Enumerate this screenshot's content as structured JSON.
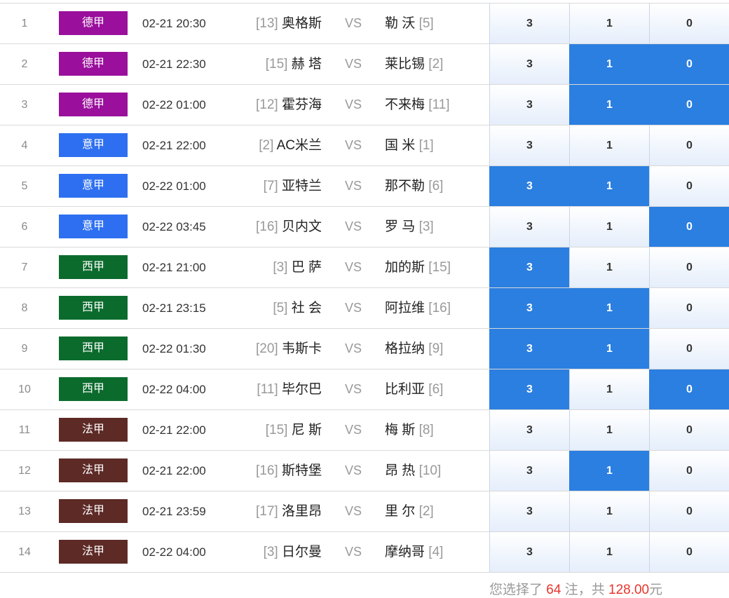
{
  "colors": {
    "bundesliga": "#9a0f9c",
    "serie_a": "#2d6ff0",
    "la_liga": "#0b6b2d",
    "ligue_1": "#5d2a26",
    "selected": "#2b7fe0",
    "highlight": "#e8342b"
  },
  "vs_label": "VS",
  "options": [
    "3",
    "1",
    "0"
  ],
  "matches": [
    {
      "no": "1",
      "league": "德甲",
      "league_color": "#9a0f9c",
      "time": "02-21 20:30",
      "home_rank": "[13]",
      "home": "奥格斯",
      "away": "勒 沃",
      "away_rank": "[5]",
      "selected": [
        false,
        false,
        false
      ]
    },
    {
      "no": "2",
      "league": "德甲",
      "league_color": "#9a0f9c",
      "time": "02-21 22:30",
      "home_rank": "[15]",
      "home": "赫 塔",
      "away": "莱比锡",
      "away_rank": "[2]",
      "selected": [
        false,
        true,
        true
      ]
    },
    {
      "no": "3",
      "league": "德甲",
      "league_color": "#9a0f9c",
      "time": "02-22 01:00",
      "home_rank": "[12]",
      "home": "霍芬海",
      "away": "不来梅",
      "away_rank": "[11]",
      "selected": [
        false,
        true,
        true
      ]
    },
    {
      "no": "4",
      "league": "意甲",
      "league_color": "#2d6ff0",
      "time": "02-21 22:00",
      "home_rank": "[2]",
      "home": "AC米兰",
      "away": "国 米",
      "away_rank": "[1]",
      "selected": [
        false,
        false,
        false
      ]
    },
    {
      "no": "5",
      "league": "意甲",
      "league_color": "#2d6ff0",
      "time": "02-22 01:00",
      "home_rank": "[7]",
      "home": "亚特兰",
      "away": "那不勒",
      "away_rank": "[6]",
      "selected": [
        true,
        true,
        false
      ]
    },
    {
      "no": "6",
      "league": "意甲",
      "league_color": "#2d6ff0",
      "time": "02-22 03:45",
      "home_rank": "[16]",
      "home": "贝内文",
      "away": "罗 马",
      "away_rank": "[3]",
      "selected": [
        false,
        false,
        true
      ]
    },
    {
      "no": "7",
      "league": "西甲",
      "league_color": "#0b6b2d",
      "time": "02-21 21:00",
      "home_rank": "[3]",
      "home": "巴 萨",
      "away": "加的斯",
      "away_rank": "[15]",
      "selected": [
        true,
        false,
        false
      ]
    },
    {
      "no": "8",
      "league": "西甲",
      "league_color": "#0b6b2d",
      "time": "02-21 23:15",
      "home_rank": "[5]",
      "home": "社 会",
      "away": "阿拉维",
      "away_rank": "[16]",
      "selected": [
        true,
        true,
        false
      ]
    },
    {
      "no": "9",
      "league": "西甲",
      "league_color": "#0b6b2d",
      "time": "02-22 01:30",
      "home_rank": "[20]",
      "home": "韦斯卡",
      "away": "格拉纳",
      "away_rank": "[9]",
      "selected": [
        true,
        true,
        false
      ]
    },
    {
      "no": "10",
      "league": "西甲",
      "league_color": "#0b6b2d",
      "time": "02-22 04:00",
      "home_rank": "[11]",
      "home": "毕尔巴",
      "away": "比利亚",
      "away_rank": "[6]",
      "selected": [
        true,
        false,
        true
      ]
    },
    {
      "no": "11",
      "league": "法甲",
      "league_color": "#5d2a26",
      "time": "02-21 22:00",
      "home_rank": "[15]",
      "home": "尼 斯",
      "away": "梅 斯",
      "away_rank": "[8]",
      "selected": [
        false,
        false,
        false
      ]
    },
    {
      "no": "12",
      "league": "法甲",
      "league_color": "#5d2a26",
      "time": "02-21 22:00",
      "home_rank": "[16]",
      "home": "斯特堡",
      "away": "昂 热",
      "away_rank": "[10]",
      "selected": [
        false,
        true,
        false
      ]
    },
    {
      "no": "13",
      "league": "法甲",
      "league_color": "#5d2a26",
      "time": "02-21 23:59",
      "home_rank": "[17]",
      "home": "洛里昂",
      "away": "里 尔",
      "away_rank": "[2]",
      "selected": [
        false,
        false,
        false
      ]
    },
    {
      "no": "14",
      "league": "法甲",
      "league_color": "#5d2a26",
      "time": "02-22 04:00",
      "home_rank": "[3]",
      "home": "日尔曼",
      "away": "摩纳哥",
      "away_rank": "[4]",
      "selected": [
        false,
        false,
        false
      ]
    }
  ],
  "summary": {
    "prefix": "您选择了",
    "bets": "64",
    "middle": "注，共",
    "amount": "128.00",
    "suffix": "元"
  }
}
